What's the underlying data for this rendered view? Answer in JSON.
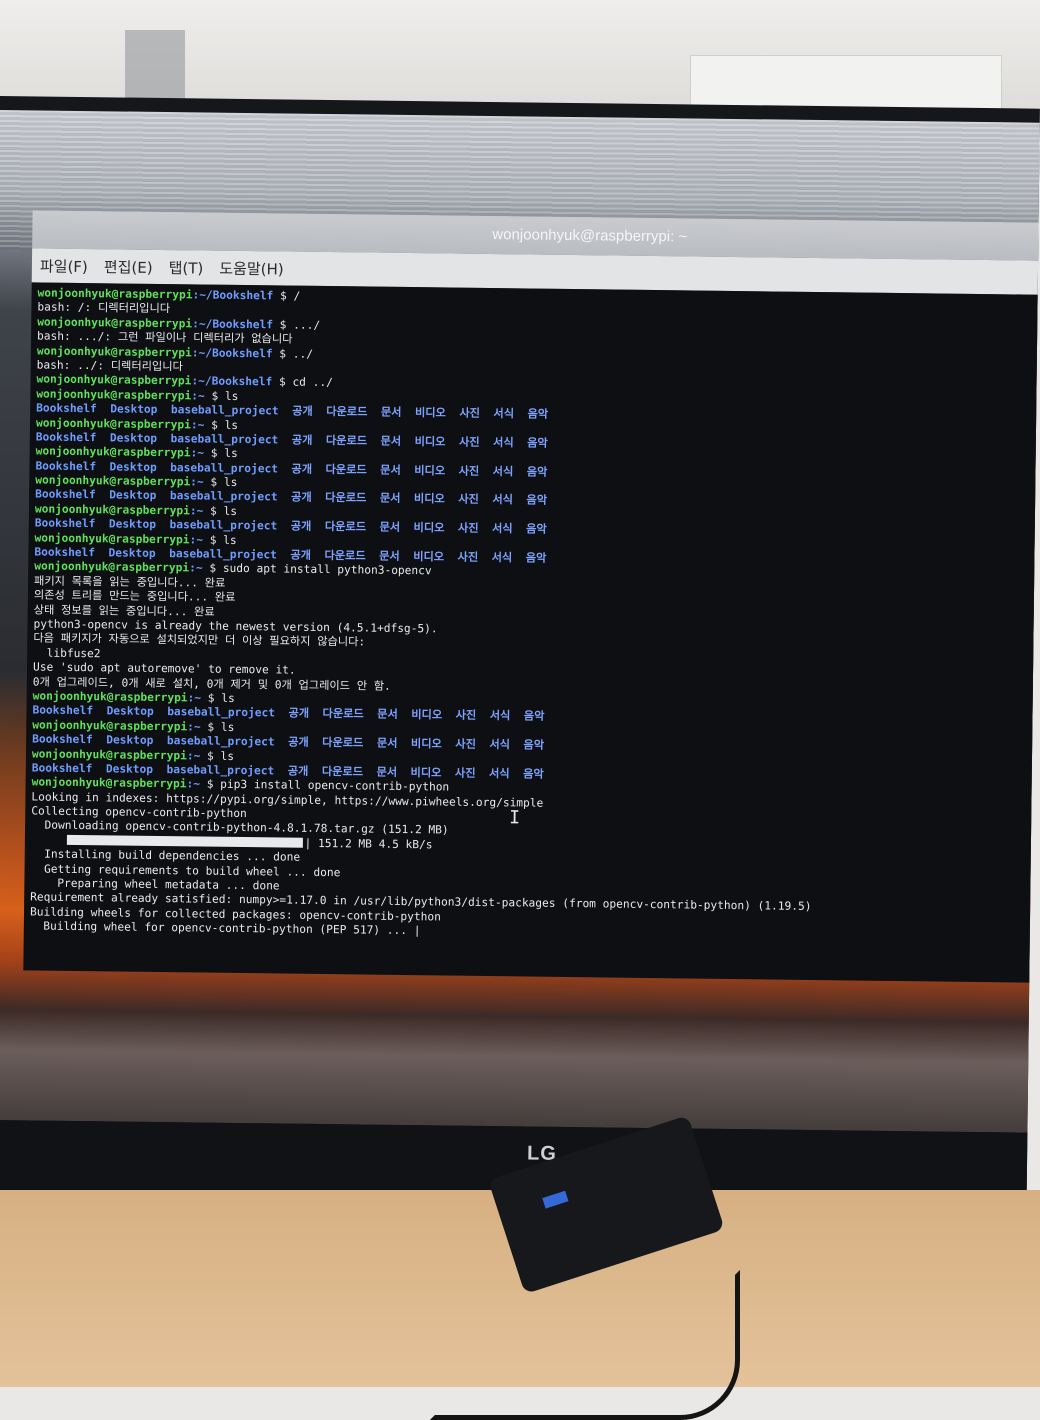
{
  "window": {
    "title": "wonjoonhyuk@raspberrypi: ~",
    "menu": [
      "파일(F)",
      "편집(E)",
      "탭(T)",
      "도움말(H)"
    ]
  },
  "brand": {
    "monitor_logo": "LG"
  },
  "colors": {
    "prompt": "#5ee05a",
    "directory": "#6f9cff",
    "background": "#0d0f13",
    "text": "#e1e3e6",
    "usb_port": "#3569d8"
  },
  "icons": {
    "text_cursor": "i-beam-cursor-icon",
    "logo": "lg-logo"
  },
  "ls_dirs": [
    "Bookshelf",
    "Desktop",
    "baseball_project",
    "공개",
    "다운로드",
    "문서",
    "비디오",
    "사진",
    "서식",
    "음악"
  ],
  "terminal": {
    "lines": [
      {
        "type": "prompt",
        "user": "wonjoonhyuk@raspberrypi",
        "path": ":~/Bookshelf",
        "cmd": " $ /"
      },
      {
        "type": "text",
        "text": "bash: /: 디렉터리입니다"
      },
      {
        "type": "prompt",
        "user": "wonjoonhyuk@raspberrypi",
        "path": ":~/Bookshelf",
        "cmd": " $ .../"
      },
      {
        "type": "text",
        "text": "bash: .../: 그런 파일이나 디렉터리가 없습니다"
      },
      {
        "type": "prompt",
        "user": "wonjoonhyuk@raspberrypi",
        "path": ":~/Bookshelf",
        "cmd": " $ ../"
      },
      {
        "type": "text",
        "text": "bash: ../: 디렉터리입니다"
      },
      {
        "type": "prompt",
        "user": "wonjoonhyuk@raspberrypi",
        "path": ":~/Bookshelf",
        "cmd": " $ cd ../"
      },
      {
        "type": "prompt",
        "user": "wonjoonhyuk@raspberrypi",
        "path": ":~",
        "cmd": " $ ls"
      },
      {
        "type": "ls"
      },
      {
        "type": "prompt",
        "user": "wonjoonhyuk@raspberrypi",
        "path": ":~",
        "cmd": " $ ls"
      },
      {
        "type": "ls"
      },
      {
        "type": "prompt",
        "user": "wonjoonhyuk@raspberrypi",
        "path": ":~",
        "cmd": " $ ls"
      },
      {
        "type": "ls"
      },
      {
        "type": "prompt",
        "user": "wonjoonhyuk@raspberrypi",
        "path": ":~",
        "cmd": " $ ls"
      },
      {
        "type": "ls"
      },
      {
        "type": "prompt",
        "user": "wonjoonhyuk@raspberrypi",
        "path": ":~",
        "cmd": " $ ls"
      },
      {
        "type": "ls"
      },
      {
        "type": "prompt",
        "user": "wonjoonhyuk@raspberrypi",
        "path": ":~",
        "cmd": " $ ls"
      },
      {
        "type": "ls"
      },
      {
        "type": "prompt",
        "user": "wonjoonhyuk@raspberrypi",
        "path": ":~",
        "cmd": " $ sudo apt install python3-opencv"
      },
      {
        "type": "text",
        "text": "패키지 목록을 읽는 중입니다... 완료"
      },
      {
        "type": "text",
        "text": "의존성 트리를 만드는 중입니다... 완료"
      },
      {
        "type": "text",
        "text": "상태 정보를 읽는 중입니다... 완료"
      },
      {
        "type": "text",
        "text": "python3-opencv is already the newest version (4.5.1+dfsg-5)."
      },
      {
        "type": "text",
        "text": "다음 패키지가 자동으로 설치되었지만 더 이상 필요하지 않습니다:"
      },
      {
        "type": "text",
        "text": "  libfuse2"
      },
      {
        "type": "text",
        "text": "Use 'sudo apt autoremove' to remove it."
      },
      {
        "type": "text",
        "text": "0개 업그레이드, 0개 새로 설치, 0개 제거 및 0개 업그레이드 안 함."
      },
      {
        "type": "prompt",
        "user": "wonjoonhyuk@raspberrypi",
        "path": ":~",
        "cmd": " $ ls"
      },
      {
        "type": "ls"
      },
      {
        "type": "prompt",
        "user": "wonjoonhyuk@raspberrypi",
        "path": ":~",
        "cmd": " $ ls"
      },
      {
        "type": "ls"
      },
      {
        "type": "prompt",
        "user": "wonjoonhyuk@raspberrypi",
        "path": ":~",
        "cmd": " $ ls"
      },
      {
        "type": "ls"
      },
      {
        "type": "prompt",
        "user": "wonjoonhyuk@raspberrypi",
        "path": ":~",
        "cmd": " $ pip3 install opencv-contrib-python"
      },
      {
        "type": "text",
        "text": "Looking in indexes: https://pypi.org/simple, https://www.piwheels.org/simple"
      },
      {
        "type": "text",
        "text": "Collecting opencv-contrib-python"
      },
      {
        "type": "text",
        "text": "  Downloading opencv-contrib-python-4.8.1.78.tar.gz (151.2 MB)"
      },
      {
        "type": "progress",
        "text": "| 151.2 MB 4.5 kB/s",
        "fraction": 1.0
      },
      {
        "type": "text",
        "text": "  Installing build dependencies ... done"
      },
      {
        "type": "text",
        "text": "  Getting requirements to build wheel ... done"
      },
      {
        "type": "text",
        "text": "    Preparing wheel metadata ... done"
      },
      {
        "type": "text",
        "text": "Requirement already satisfied: numpy>=1.17.0 in /usr/lib/python3/dist-packages (from opencv-contrib-python) (1.19.5)"
      },
      {
        "type": "text",
        "text": "Building wheels for collected packages: opencv-contrib-python"
      },
      {
        "type": "cursor",
        "text": "  Building wheel for opencv-contrib-python (PEP 517) ... |"
      }
    ]
  }
}
